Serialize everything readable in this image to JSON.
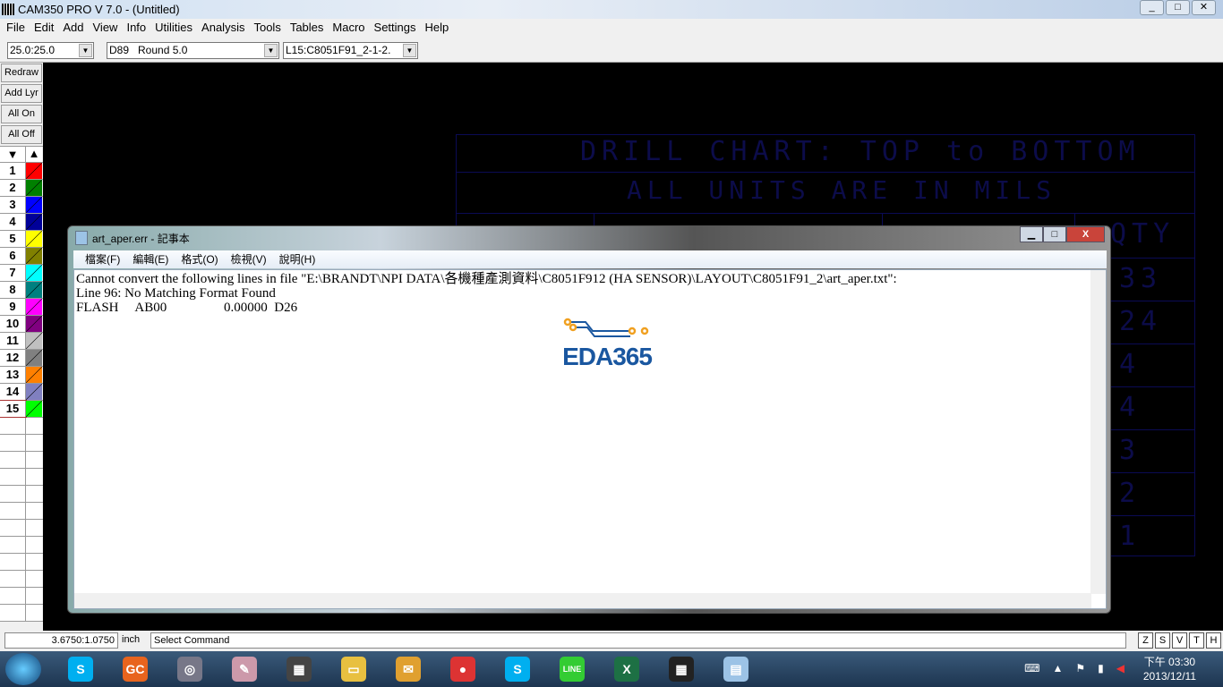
{
  "app": {
    "title": "CAM350 PRO V 7.0 - (Untitled)",
    "controls": [
      "_",
      "□",
      "✕"
    ]
  },
  "menu": [
    "File",
    "Edit",
    "Add",
    "View",
    "Info",
    "Utilities",
    "Analysis",
    "Tools",
    "Tables",
    "Macro",
    "Settings",
    "Help"
  ],
  "toolbar": {
    "grid": "25.0:25.0",
    "dcode": "D89   Round 5.0",
    "layer": "L15:C8051F91_2-1-2."
  },
  "sidebar": {
    "buttons": [
      "Redraw",
      "Add Lyr",
      "All On",
      "All Off"
    ],
    "down": "▼",
    "up": "▲",
    "layers": [
      {
        "n": "1",
        "color": "#ff0000"
      },
      {
        "n": "2",
        "color": "#008000"
      },
      {
        "n": "3",
        "color": "#0000ff"
      },
      {
        "n": "4",
        "color": "#000099"
      },
      {
        "n": "5",
        "color": "#ffff00"
      },
      {
        "n": "6",
        "color": "#808000"
      },
      {
        "n": "7",
        "color": "#00ffff"
      },
      {
        "n": "8",
        "color": "#008080"
      },
      {
        "n": "9",
        "color": "#ff00ff"
      },
      {
        "n": "10",
        "color": "#800080"
      },
      {
        "n": "11",
        "color": "#c0c0c0"
      },
      {
        "n": "12",
        "color": "#808080"
      },
      {
        "n": "13",
        "color": "#ff8000"
      },
      {
        "n": "14",
        "color": "#8080c0"
      },
      {
        "n": "15",
        "color": "#00ff00"
      }
    ]
  },
  "drill": {
    "title": "DRILL CHART: TOP to BOTTOM",
    "units": "ALL UNITS ARE IN MILS",
    "qty_header": "QTY",
    "qty": [
      "33",
      "24",
      "4",
      "4",
      "3",
      "2",
      "1"
    ]
  },
  "notepad": {
    "title": "art_aper.err - 記事本",
    "menu": [
      "檔案(F)",
      "編輯(E)",
      "格式(O)",
      "檢視(V)",
      "說明(H)"
    ],
    "lines": [
      "Cannot convert the following lines in file \"E:\\BRANDT\\NPI DATA\\各機種產測資料\\C8051F912 (HA SENSOR)\\LAYOUT\\C8051F91_2\\art_aper.txt\":",
      "Line 96: No Matching Format Found",
      "FLASH     AB00                 0.00000  D26"
    ]
  },
  "watermark": "EDA365",
  "status": {
    "coords": "3.6750:1.0750",
    "unit": "inch",
    "command": "Select Command",
    "modes": [
      "Z",
      "S",
      "V",
      "T",
      "H"
    ]
  },
  "taskbar": {
    "apps": [
      {
        "name": "skype",
        "label": "S",
        "color": "#00aff0"
      },
      {
        "name": "gc",
        "label": "GC",
        "color": "#e8641e"
      },
      {
        "name": "globe",
        "label": "◎",
        "color": "#778"
      },
      {
        "name": "paint",
        "label": "✎",
        "color": "#c9a"
      },
      {
        "name": "cam350",
        "label": "▦",
        "color": "#444"
      },
      {
        "name": "explorer",
        "label": "▭",
        "color": "#e8c040"
      },
      {
        "name": "outlook",
        "label": "✉",
        "color": "#e0a030"
      },
      {
        "name": "chrome",
        "label": "●",
        "color": "#d33"
      },
      {
        "name": "skype2",
        "label": "S",
        "color": "#00aff0"
      },
      {
        "name": "line",
        "label": "LINE",
        "color": "#3c3"
      },
      {
        "name": "excel",
        "label": "X",
        "color": "#1d7044"
      },
      {
        "name": "cam350-2",
        "label": "▦",
        "color": "#222"
      },
      {
        "name": "notepad",
        "label": "▤",
        "color": "#9cc3e6"
      }
    ],
    "time": "下午 03:30",
    "date": "2013/12/11"
  }
}
